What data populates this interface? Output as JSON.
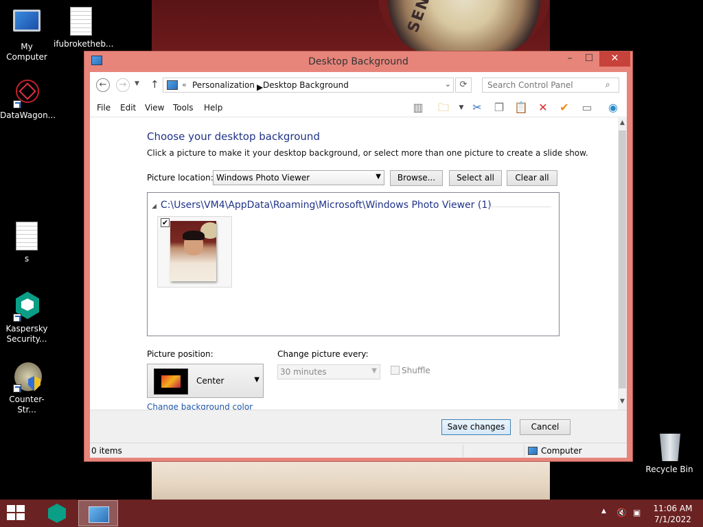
{
  "desktop": {
    "icons": [
      {
        "label": "My Computer"
      },
      {
        "label": "ifubroketheb..."
      },
      {
        "label": "DataWagon..."
      },
      {
        "label": "s"
      },
      {
        "label": "Kaspersky Security..."
      },
      {
        "label": "Counter-Str..."
      },
      {
        "label": "Recycle Bin"
      }
    ]
  },
  "window": {
    "title": "Desktop Background",
    "controls": {
      "minimize": "–",
      "maximize": "☐",
      "close": "✕"
    }
  },
  "address": {
    "back": "←",
    "forward": "→",
    "up": "↑",
    "chevron": "«",
    "crumbs": [
      "Personalization",
      "Desktop Background"
    ],
    "crumb_separator": "▶",
    "search_placeholder": "Search Control Panel"
  },
  "menu": [
    "File",
    "Edit",
    "View",
    "Tools",
    "Help"
  ],
  "toolbar_icons": [
    "layout-icon",
    "properties-icon",
    "cut-icon",
    "copy-icon",
    "paste-icon",
    "delete-icon",
    "check-icon",
    "view-icon",
    "globe-icon"
  ],
  "content": {
    "heading": "Choose your desktop background",
    "subtitle": "Click a picture to make it your desktop background, or select more than one picture to create a slide show.",
    "picture_location_label": "Picture location:",
    "picture_location_value": "Windows Photo Viewer",
    "buttons": {
      "browse": "Browse...",
      "select_all": "Select all",
      "clear_all": "Clear all"
    },
    "folder": "C:\\Users\\VM4\\AppData\\Roaming\\Microsoft\\Windows Photo Viewer (1)",
    "thumbnail_checked": true,
    "picture_position_label": "Picture position:",
    "picture_position_value": "Center",
    "change_every_label": "Change picture every:",
    "change_every_value": "30 minutes",
    "shuffle_label": "Shuffle",
    "bg_color_link": "Change background color"
  },
  "footer": {
    "save": "Save changes",
    "cancel": "Cancel"
  },
  "status": {
    "items": "0 items",
    "location": "Computer"
  },
  "taskbar": {
    "time": "11:06 AM",
    "date": "7/1/2022"
  }
}
